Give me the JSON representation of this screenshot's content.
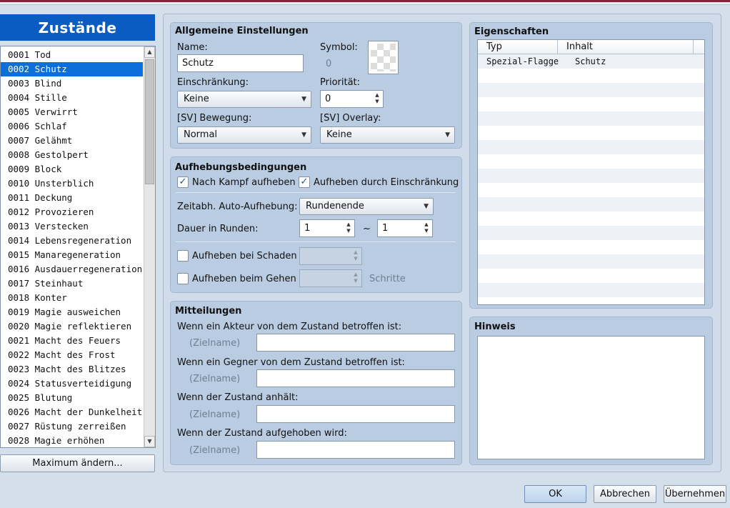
{
  "left": {
    "title": "Zustände",
    "items": [
      "0001 Tod",
      "0002 Schutz",
      "0003 Blind",
      "0004 Stille",
      "0005 Verwirrt",
      "0006 Schlaf",
      "0007 Gelähmt",
      "0008 Gestolpert",
      "0009 Block",
      "0010 Unsterblich",
      "0011 Deckung",
      "0012 Provozieren",
      "0013 Verstecken",
      "0014 Lebensregeneration",
      "0015 Manaregeneration",
      "0016 Ausdauerregeneration",
      "0017 Steinhaut",
      "0018 Konter",
      "0019 Magie ausweichen",
      "0020 Magie reflektieren",
      "0021 Macht des Feuers",
      "0022 Macht des Frost",
      "0023 Macht des Blitzes",
      "0024 Statusverteidigung",
      "0025 Blutung",
      "0026 Macht der Dunkelheit",
      "0027 Rüstung zerreißen",
      "0028 Magie erhöhen"
    ],
    "selected_index": 1,
    "max_button": "Maximum ändern..."
  },
  "general": {
    "title": "Allgemeine Einstellungen",
    "name_label": "Name:",
    "name_value": "Schutz",
    "symbol_label": "Symbol:",
    "symbol_value": "0",
    "restriction_label": "Einschränkung:",
    "restriction_value": "Keine",
    "priority_label": "Priorität:",
    "priority_value": "0",
    "sv_motion_label": "[SV] Bewegung:",
    "sv_motion_value": "Normal",
    "sv_overlay_label": "[SV] Overlay:",
    "sv_overlay_value": "Keine"
  },
  "removal": {
    "title": "Aufhebungsbedingungen",
    "after_battle_label": "Nach Kampf aufheben",
    "after_battle_checked": true,
    "by_restriction_label": "Aufheben durch Einschränkung",
    "by_restriction_checked": true,
    "auto_removal_label": "Zeitabh. Auto-Aufhebung:",
    "auto_removal_value": "Rundenende",
    "duration_label": "Dauer in Runden:",
    "duration_min": "1",
    "duration_sep": "~",
    "duration_max": "1",
    "by_damage_label": "Aufheben bei Schaden",
    "by_damage_checked": false,
    "by_walking_label": "Aufheben beim Gehen",
    "by_walking_checked": false,
    "steps_label": "Schritte"
  },
  "messages": {
    "title": "Mitteilungen",
    "placeholder": "(Zielname)",
    "rows": [
      {
        "label": "Wenn ein Akteur von dem Zustand betroffen ist:",
        "value": ""
      },
      {
        "label": "Wenn ein Gegner von dem Zustand betroffen ist:",
        "value": ""
      },
      {
        "label": "Wenn der Zustand anhält:",
        "value": ""
      },
      {
        "label": "Wenn der Zustand aufgehoben wird:",
        "value": ""
      }
    ]
  },
  "traits": {
    "title": "Eigenschaften",
    "col_type": "Typ",
    "col_content": "Inhalt",
    "rows": [
      {
        "type": "Spezial-Flagge",
        "content": "Schutz"
      }
    ]
  },
  "note": {
    "title": "Hinweis",
    "value": ""
  },
  "footer": {
    "ok": "OK",
    "cancel": "Abbrechen",
    "apply": "Übernehmen"
  },
  "colors": {
    "accent": "#0a5bc2",
    "selection": "#0a6fd8",
    "group_bg": "#b9cce2",
    "window_bg": "#d4dfec"
  }
}
